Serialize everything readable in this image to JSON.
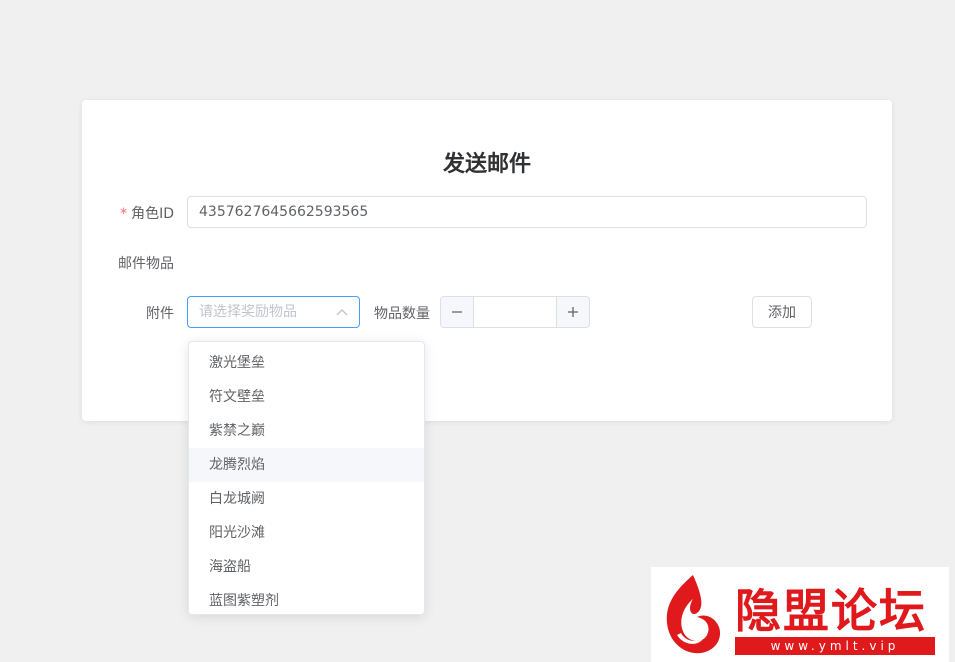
{
  "form": {
    "title": "发送邮件",
    "role_id_required_mark": "*",
    "role_id_label": "角色ID",
    "role_id_value": "4357627645662593565",
    "mail_items_label": "邮件物品",
    "attachment_label": "附件",
    "attachment_placeholder": "请选择奖励物品",
    "quantity_label": "物品数量",
    "quantity_value": "",
    "add_label": "添加"
  },
  "dropdown": {
    "options": [
      "激光堡垒",
      "符文壁垒",
      "紫禁之巅",
      "龙腾烈焰",
      "白龙城阙",
      "阳光沙滩",
      "海盗船",
      "蓝图紫塑剂"
    ],
    "hovered_index": 3
  },
  "watermark": {
    "title": "隐盟论坛",
    "url": "www.ymlt.vip"
  },
  "colors": {
    "focus_border": "#409eff",
    "required": "#f56c6c",
    "watermark_red": "#e0191c"
  },
  "icons": {
    "select_arrow": "chevron-up-icon",
    "decrement": "minus-icon",
    "increment": "plus-icon",
    "watermark_logo": "flame-logo-icon"
  }
}
